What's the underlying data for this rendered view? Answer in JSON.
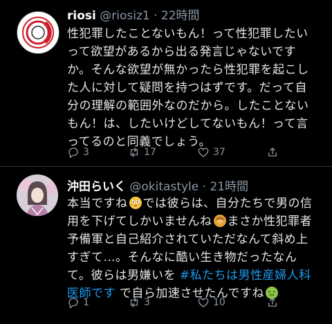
{
  "tweets": [
    {
      "author": "riosi",
      "handle": "@riosiz1",
      "time": "· 22時間",
      "lines": [
        "性犯罪したことないもん！って性犯罪したい",
        "って欲望があるから出る発言じゃないです",
        "か。そんな欲望が無かったら性犯罪を起こし",
        "た人に対して疑問を持つはずです。だって自",
        "分の理解の範囲外なのだから。したことない",
        "もん！は、したいけどしてないもん！って言",
        "ってるのと同義でしょう。"
      ],
      "replies": "3",
      "retweets": "17",
      "likes": "37"
    },
    {
      "author": "沖田らいく",
      "handle": "@okitastyle",
      "time": "· 21時間",
      "line1a": "本当ですね",
      "line1b": "では彼らは、自分たちで男の信",
      "line2a": "用を下げてしかいませんね",
      "line2b": "まさか性犯罪者",
      "line3": "予備軍と自己紹介されていただなんて斜め上",
      "line4": "すぎて…。そんなに酷い生き物だったなん",
      "line5a": "て。彼らは男嫌いを",
      "hashtag1": "#私たちは男性産婦人科",
      "hashtag2": "医師です",
      "line6b": "で自ら加速させたんですね",
      "replies": "1",
      "retweets": "3",
      "likes": "10"
    }
  ],
  "colors": {
    "background": "#000000",
    "text": "#e6e6e6",
    "muted": "#8b98a5",
    "link": "#1d9bf0"
  },
  "icons": [
    "reply-icon",
    "retweet-icon",
    "like-icon",
    "share-icon"
  ]
}
